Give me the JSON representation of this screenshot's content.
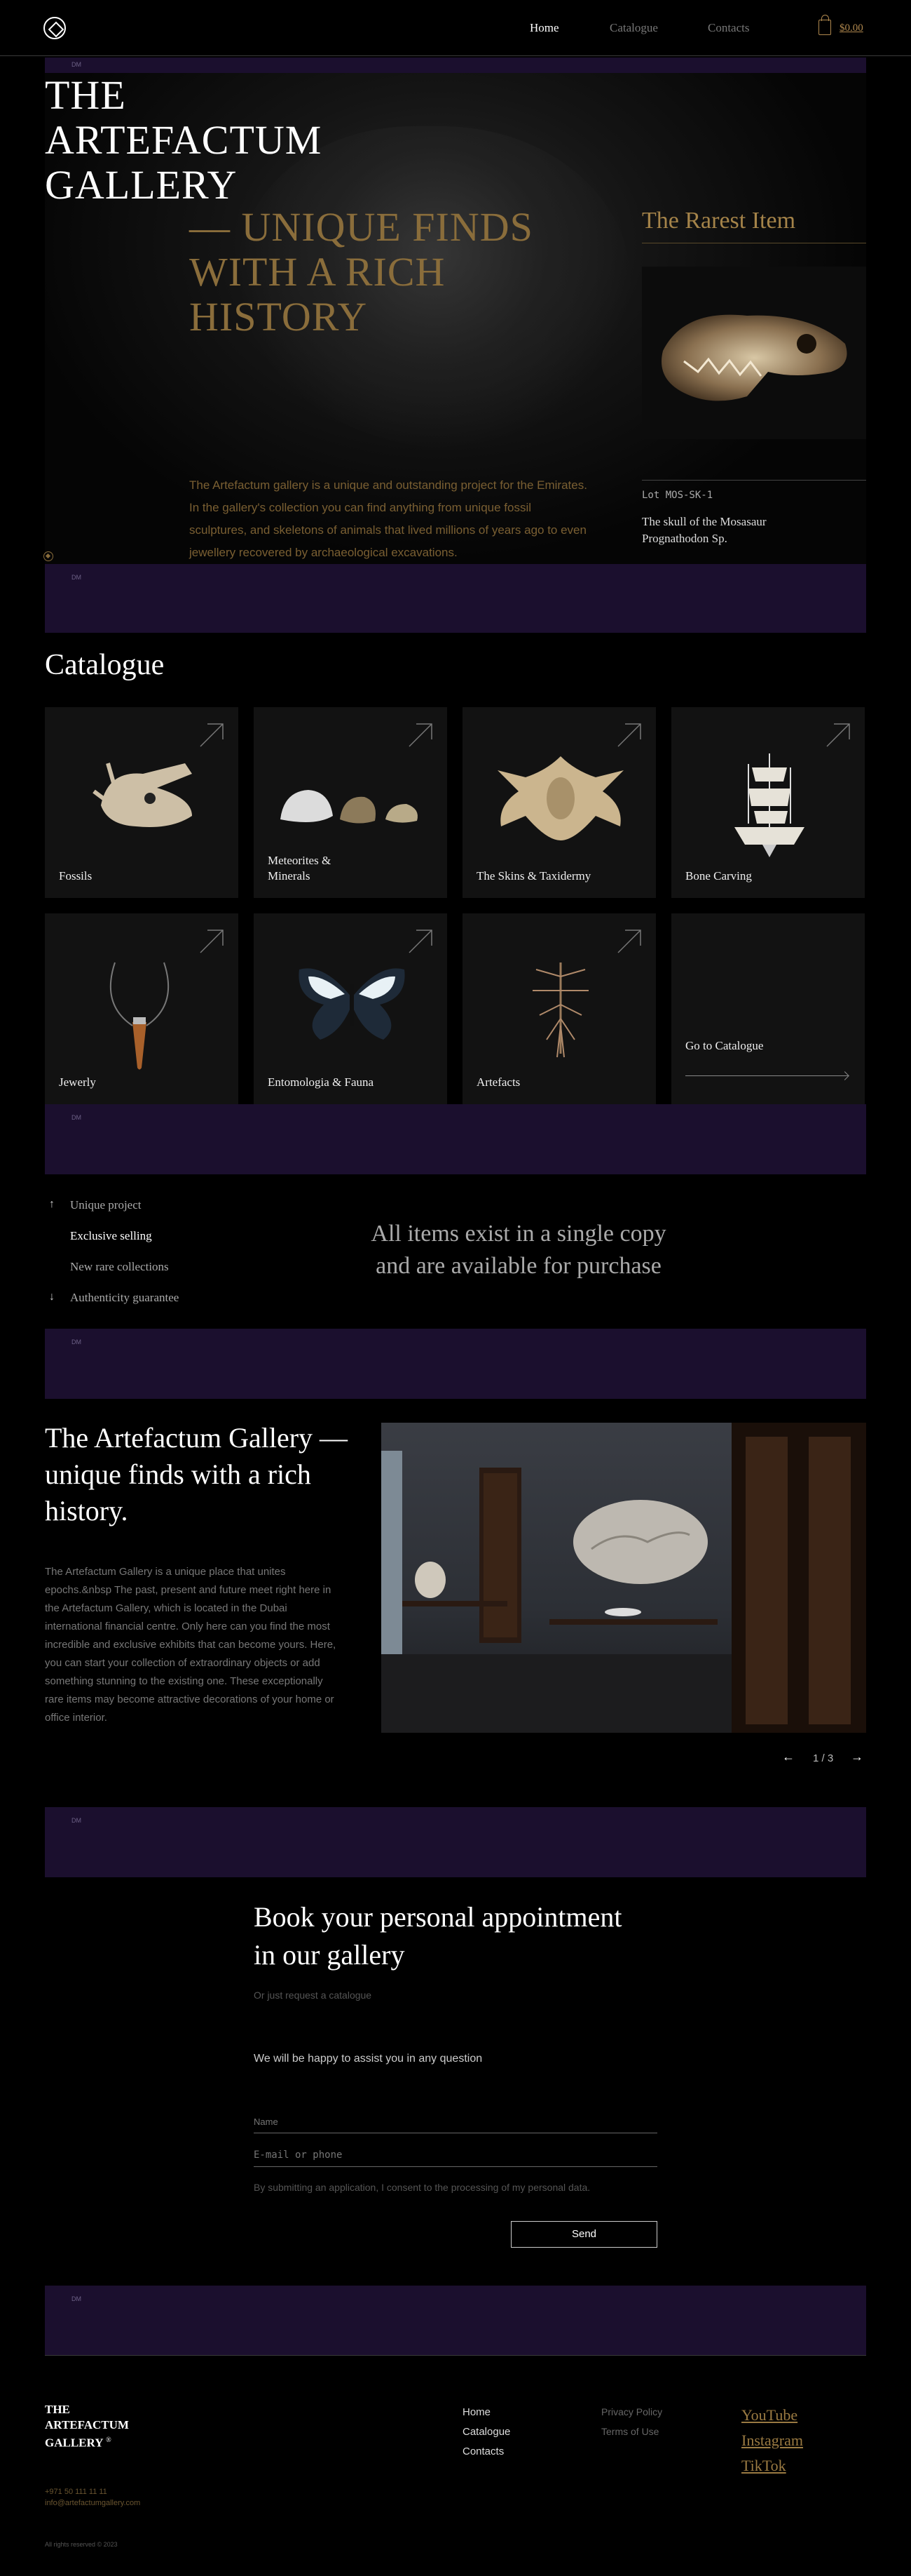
{
  "header": {
    "nav": [
      "Home",
      "Catalogue",
      "Contacts"
    ],
    "cart_total": "$0.00"
  },
  "bands": {
    "label": "DM"
  },
  "hero": {
    "title_lines": [
      "THE",
      "ARTEFACTUM",
      "GALLERY"
    ],
    "subtitle_lines": [
      "— UNIQUE FINDS",
      "WITH A RICH",
      "HISTORY"
    ],
    "text": "The Artefactum gallery is a unique and outstanding project for the Emirates. In the gallery's collection you can find anything from unique fossil sculptures, and skeletons of animals that lived millions of years ago to even jewellery recovered by archaeological excavations.",
    "rarest_title": "The Rarest Item",
    "lot": "Lot MOS-SK-1",
    "lot_name": "The skull of the Mosasaur Prognathodon Sp."
  },
  "catalogue": {
    "title": "Catalogue",
    "cards": [
      {
        "label": "Fossils"
      },
      {
        "label": "Meteorites & Minerals"
      },
      {
        "label": "The Skins & Taxidermy"
      },
      {
        "label": "Bone Carving"
      },
      {
        "label": "Jewerly"
      },
      {
        "label": "Entomologia & Fauna"
      },
      {
        "label": "Artefacts"
      },
      {
        "label": "Go to Catalogue"
      }
    ]
  },
  "features": {
    "items": [
      "Unique project",
      "Exclusive selling",
      "New rare collections",
      "Authenticity guarantee"
    ],
    "copy_line1": "All items exist in a single copy",
    "copy_line2": "and are available for purchase"
  },
  "about": {
    "title": "The Artefactum Gallery — unique finds with a rich history.",
    "text": "The Artefactum Gallery is a unique place that unites epochs.&nbsp The past, present and future meet right here in the Artefactum Gallery, which is located in the Dubai international financial centre.  Only here can you find the most incredible and exclusive exhibits that can become yours. Here, you can start your collection of extraordinary objects or add something stunning to the existing one. These exceptionally rare items may become attractive decorations of your home or office interior.",
    "slider_prev": "←",
    "slider_count": "1 / 3",
    "slider_next": "→"
  },
  "booking": {
    "title": "Book your personal appointment in our gallery",
    "subtitle": "Or just request a catalogue",
    "assist": "We will be happy to assist you in any question",
    "name_label": "Name",
    "email_placeholder": "E-mail or phone",
    "consent": "By submitting an application, I consent to the processing of my personal data.",
    "send": "Send"
  },
  "footer": {
    "logo_lines": [
      "THE",
      "ARTEFACTUM",
      "GALLERY"
    ],
    "logo_mark": "®",
    "nav": [
      "Home",
      "Catalogue",
      "Contacts"
    ],
    "legal": [
      "Privacy Policy",
      "Terms of Use"
    ],
    "social": [
      "YouTube",
      "Instagram",
      "TikTok"
    ],
    "phone": "+971 50 111 11 11",
    "email": "info@artefactumgallery.com",
    "rights": "All rights reserved © 2023"
  }
}
